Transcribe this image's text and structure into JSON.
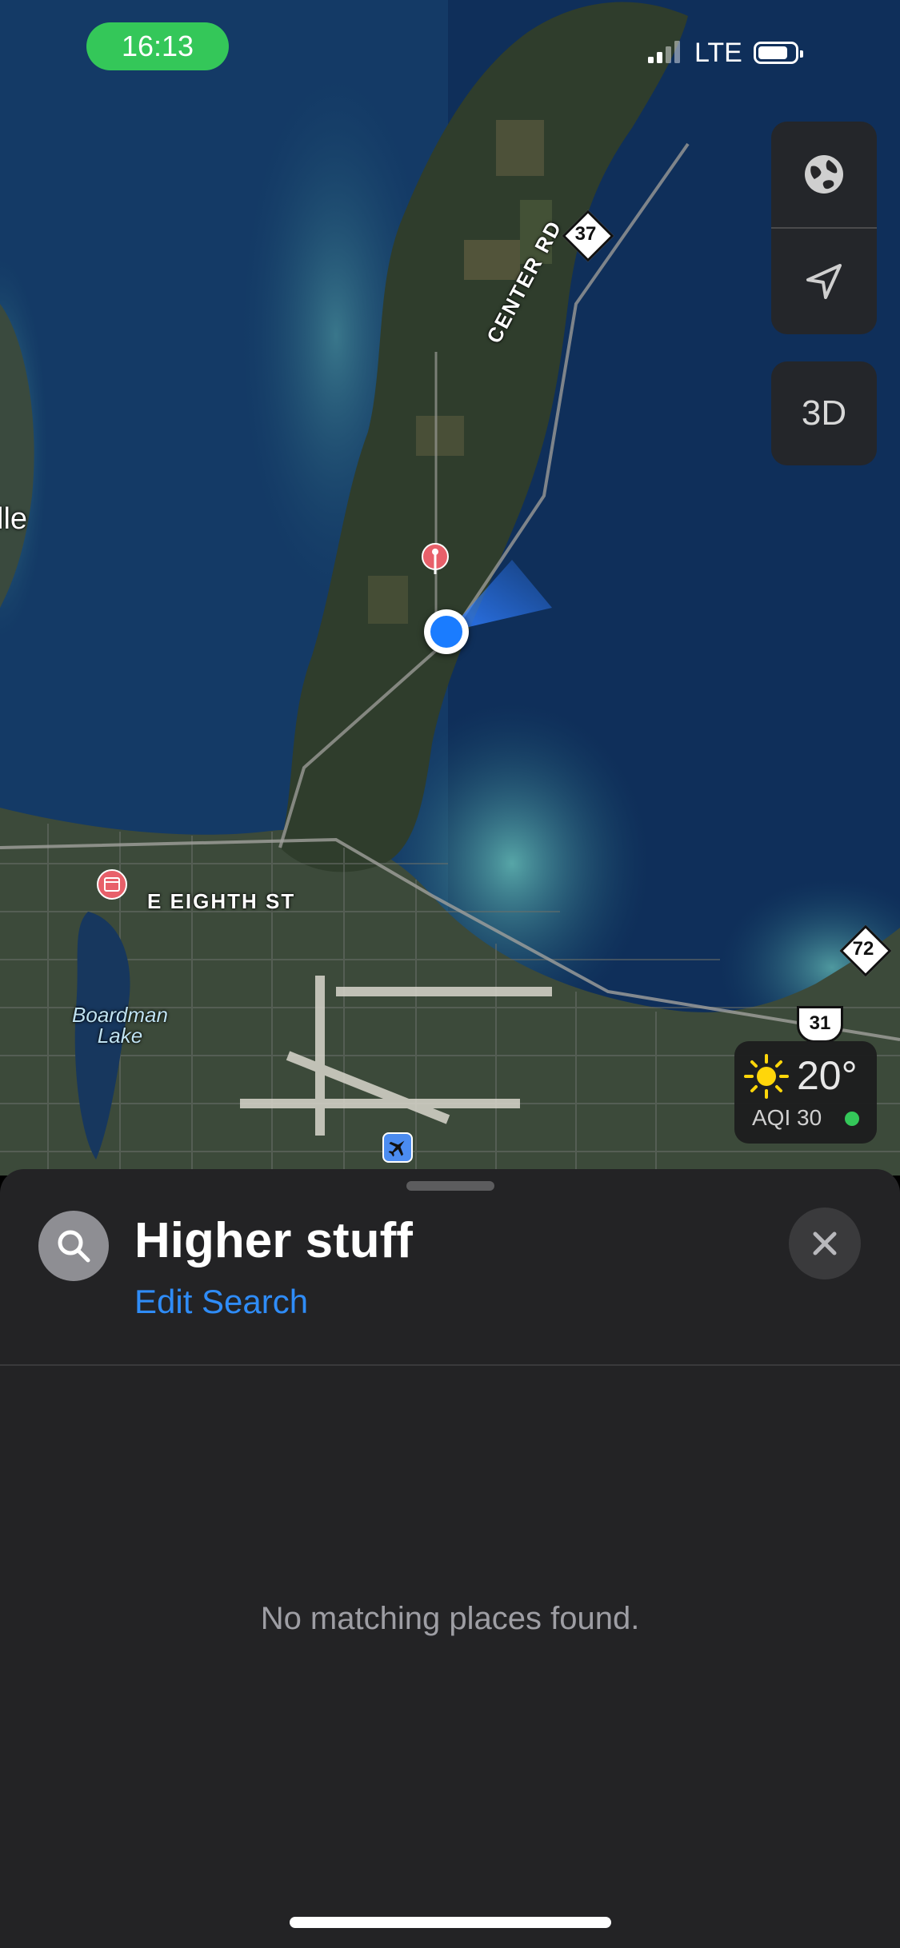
{
  "status_bar": {
    "time": "16:13",
    "network": "LTE",
    "battery_level_percent": 85
  },
  "map": {
    "labels": {
      "ville": "lle",
      "center_rd": "CENTER RD",
      "eighth_st": "E EIGHTH ST",
      "lake": "Boardman Lake"
    },
    "shields": {
      "m37": "37",
      "m72": "72",
      "us31": "31"
    },
    "icons": [
      "location-pin-icon",
      "current-location-icon",
      "calendar-poi-icon",
      "airport-icon"
    ]
  },
  "controls": {
    "globe": "globe-icon",
    "locate": "location-arrow-icon",
    "three_d": "3D"
  },
  "weather": {
    "temperature": "20°",
    "aqi": "AQI 30",
    "aqi_color": "#34c759"
  },
  "sheet": {
    "title": "Higher stuff",
    "edit_search": "Edit Search",
    "empty_message": "No matching places found."
  }
}
